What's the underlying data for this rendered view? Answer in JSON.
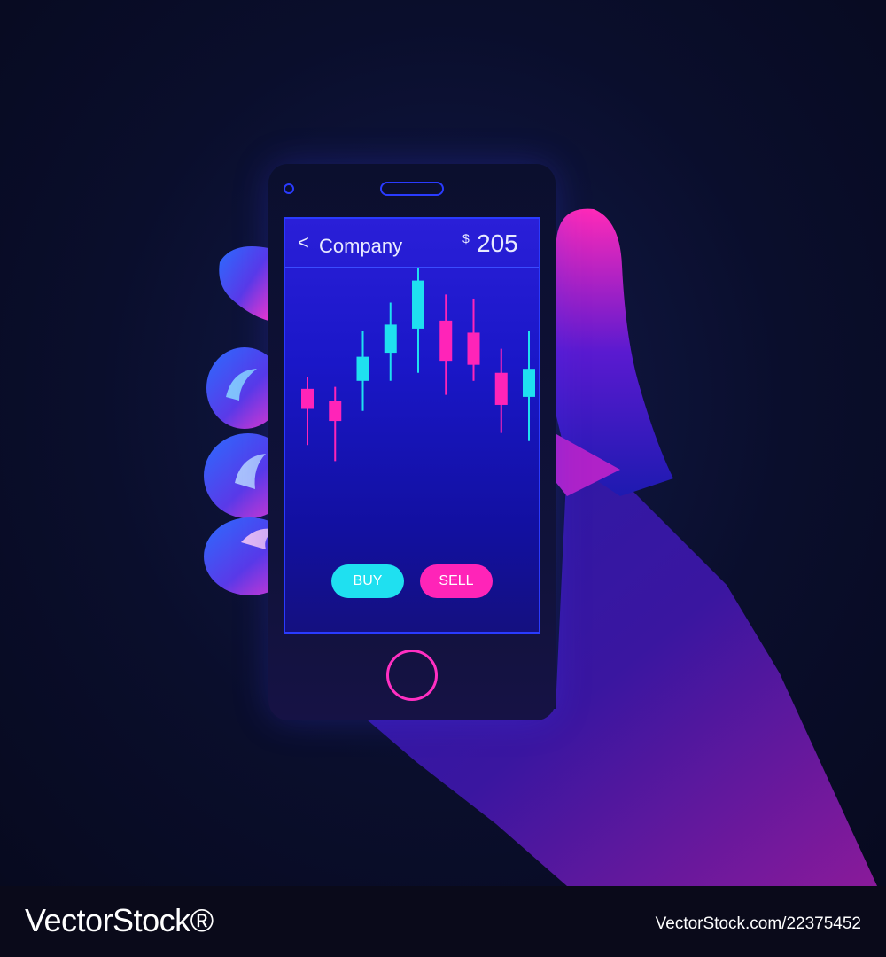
{
  "app": {
    "back_glyph": "<",
    "title": "Company",
    "currency": "$",
    "price": "205"
  },
  "actions": {
    "buy_label": "BUY",
    "sell_label": "SELL"
  },
  "colors": {
    "accent_cyan": "#1fe0f0",
    "accent_magenta": "#ff24b8",
    "screen_blue": "#1a17c8",
    "frame_blue": "#2a3bff"
  },
  "chart_data": {
    "type": "candlestick",
    "candles": [
      {
        "direction": "down",
        "open": 0.46,
        "close": 0.36,
        "high": 0.52,
        "low": 0.18
      },
      {
        "direction": "down",
        "open": 0.4,
        "close": 0.3,
        "high": 0.47,
        "low": 0.1
      },
      {
        "direction": "up",
        "open": 0.5,
        "close": 0.62,
        "high": 0.75,
        "low": 0.35
      },
      {
        "direction": "up",
        "open": 0.64,
        "close": 0.78,
        "high": 0.89,
        "low": 0.5
      },
      {
        "direction": "up",
        "open": 0.76,
        "close": 1.0,
        "high": 1.06,
        "low": 0.54
      },
      {
        "direction": "down",
        "open": 0.8,
        "close": 0.6,
        "high": 0.93,
        "low": 0.43
      },
      {
        "direction": "down",
        "open": 0.74,
        "close": 0.58,
        "high": 0.91,
        "low": 0.5
      },
      {
        "direction": "down",
        "open": 0.54,
        "close": 0.38,
        "high": 0.66,
        "low": 0.24
      },
      {
        "direction": "up",
        "open": 0.42,
        "close": 0.56,
        "high": 0.75,
        "low": 0.2
      }
    ],
    "colors": {
      "up": "#1fe0f0",
      "down": "#ff24b8"
    }
  },
  "watermark": {
    "brand": "VectorStock®",
    "image_id": "VectorStock.com/22375452"
  }
}
